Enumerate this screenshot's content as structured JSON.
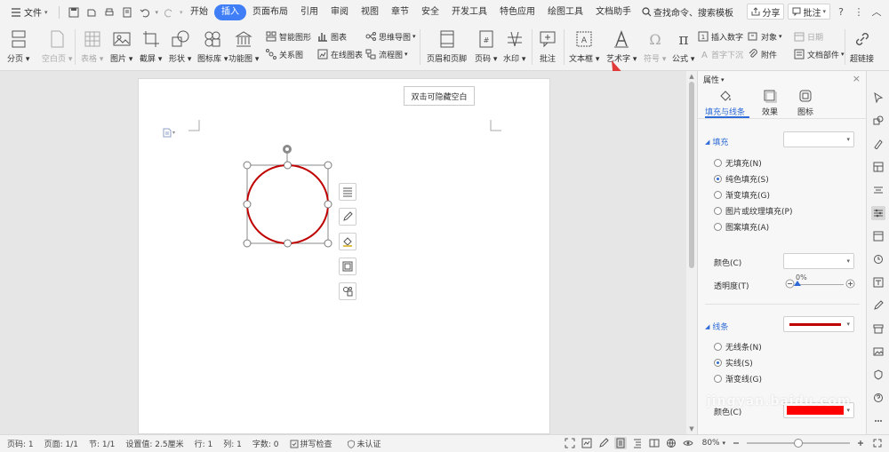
{
  "menubar": {
    "file_label": "文件",
    "tabs": [
      "开始",
      "插入",
      "页面布局",
      "引用",
      "审阅",
      "视图",
      "章节",
      "安全",
      "开发工具",
      "特色应用",
      "绘图工具",
      "文档助手"
    ],
    "active_tab": "插入",
    "search_label": "查找命令、搜索模板",
    "share_label": "分享",
    "comment_label": "批注"
  },
  "ribbon": {
    "page_break": "分页",
    "blank_page": "空白页",
    "table": "表格",
    "picture": "图片",
    "screenshot": "截屏",
    "shape": "形状",
    "icon_lib": "图标库",
    "func_chart": "功能图",
    "smart_shape": "智能图形",
    "chart": "图表",
    "relation": "关系图",
    "online_chart": "在线图表",
    "mind_map": "思维导图",
    "flowchart": "流程图",
    "header_footer": "页眉和页脚",
    "page_number": "页码",
    "watermark": "水印",
    "comment": "批注",
    "textbox": "文本框",
    "wordart": "艺术字",
    "symbol": "符号",
    "formula": "公式",
    "insert_number": "插入数字",
    "object": "对象",
    "date": "日期",
    "drop_cap": "首字下沉",
    "attachment": "附件",
    "doc_parts": "文档部件",
    "hyperlink": "超链接"
  },
  "document": {
    "hide_blank_tip": "双击可隐藏空白",
    "shape": {
      "type": "circle",
      "stroke_color": "#c00000"
    }
  },
  "panel": {
    "title": "属性",
    "tabs": [
      "填充与线条",
      "效果",
      "图标"
    ],
    "fill_section": "填充",
    "fill_options": [
      "无填充(N)",
      "纯色填充(S)",
      "渐变填充(G)",
      "图片或纹理填充(P)",
      "图案填充(A)"
    ],
    "fill_selected": "纯色填充(S)",
    "color_label": "颜色(C)",
    "transparency_label": "透明度(T)",
    "transparency_value": "0%",
    "line_section": "线条",
    "line_options": [
      "无线条(N)",
      "实线(S)",
      "渐变线(G)"
    ],
    "line_selected": "实线(S)",
    "line_color_label": "颜色(C)",
    "line_color": "#ff0000",
    "line_preview_color": "#c00000"
  },
  "statusbar": {
    "page_num": "页码: 1",
    "page_count": "页面: 1/1",
    "section": "节: 1/1",
    "setting": "设置值: 2.5厘米",
    "row": "行: 1",
    "col": "列: 1",
    "words": "字数: 0",
    "spellcheck": "拼写检查",
    "auth": "未认证",
    "zoom": "80%",
    "zoom_level": 0.5
  },
  "watermark_text": "jingyan.baidu.com"
}
